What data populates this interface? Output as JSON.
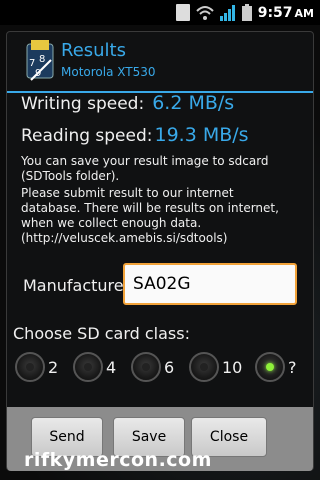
{
  "status_bar": {
    "time": "9:57",
    "ampm": "AM"
  },
  "dialog": {
    "title": "Results",
    "subtitle": "Motorola XT530",
    "writing_label": "Writing speed:",
    "writing_value": "6.2 MB/s",
    "reading_label": "Reading speed:",
    "reading_value": "19.3 MB/s",
    "note1_line1": "You can save your result image to sdcard",
    "note1_line2": "(SDTools folder).",
    "note2_line1": "Please submit result to our internet",
    "note2_line2": "database. There will be results on internet,",
    "note2_line3": "when we collect enough data.",
    "note2_line4": "(http://veluscek.amebis.si/sdtools)",
    "manufacturer_label": "Manufacturer:",
    "manufacturer_value": "SA02G",
    "class_label": "Choose SD card class:",
    "classes": [
      {
        "label": "2",
        "selected": false
      },
      {
        "label": "4",
        "selected": false
      },
      {
        "label": "6",
        "selected": false
      },
      {
        "label": "10",
        "selected": false
      },
      {
        "label": "?",
        "selected": true
      }
    ],
    "buttons": {
      "send": "Send",
      "save": "Save",
      "close": "Close"
    }
  },
  "watermark": "rifkymercon.com",
  "colors": {
    "accent": "#39a9e9",
    "selected_radio": "#8ef03a",
    "input_border": "#f2a33a"
  },
  "icons": {
    "usb": "usb-debug-icon",
    "wifi": "wifi-icon",
    "signal": "signal-icon",
    "battery": "battery-icon",
    "app": "sdtools-app-icon"
  }
}
